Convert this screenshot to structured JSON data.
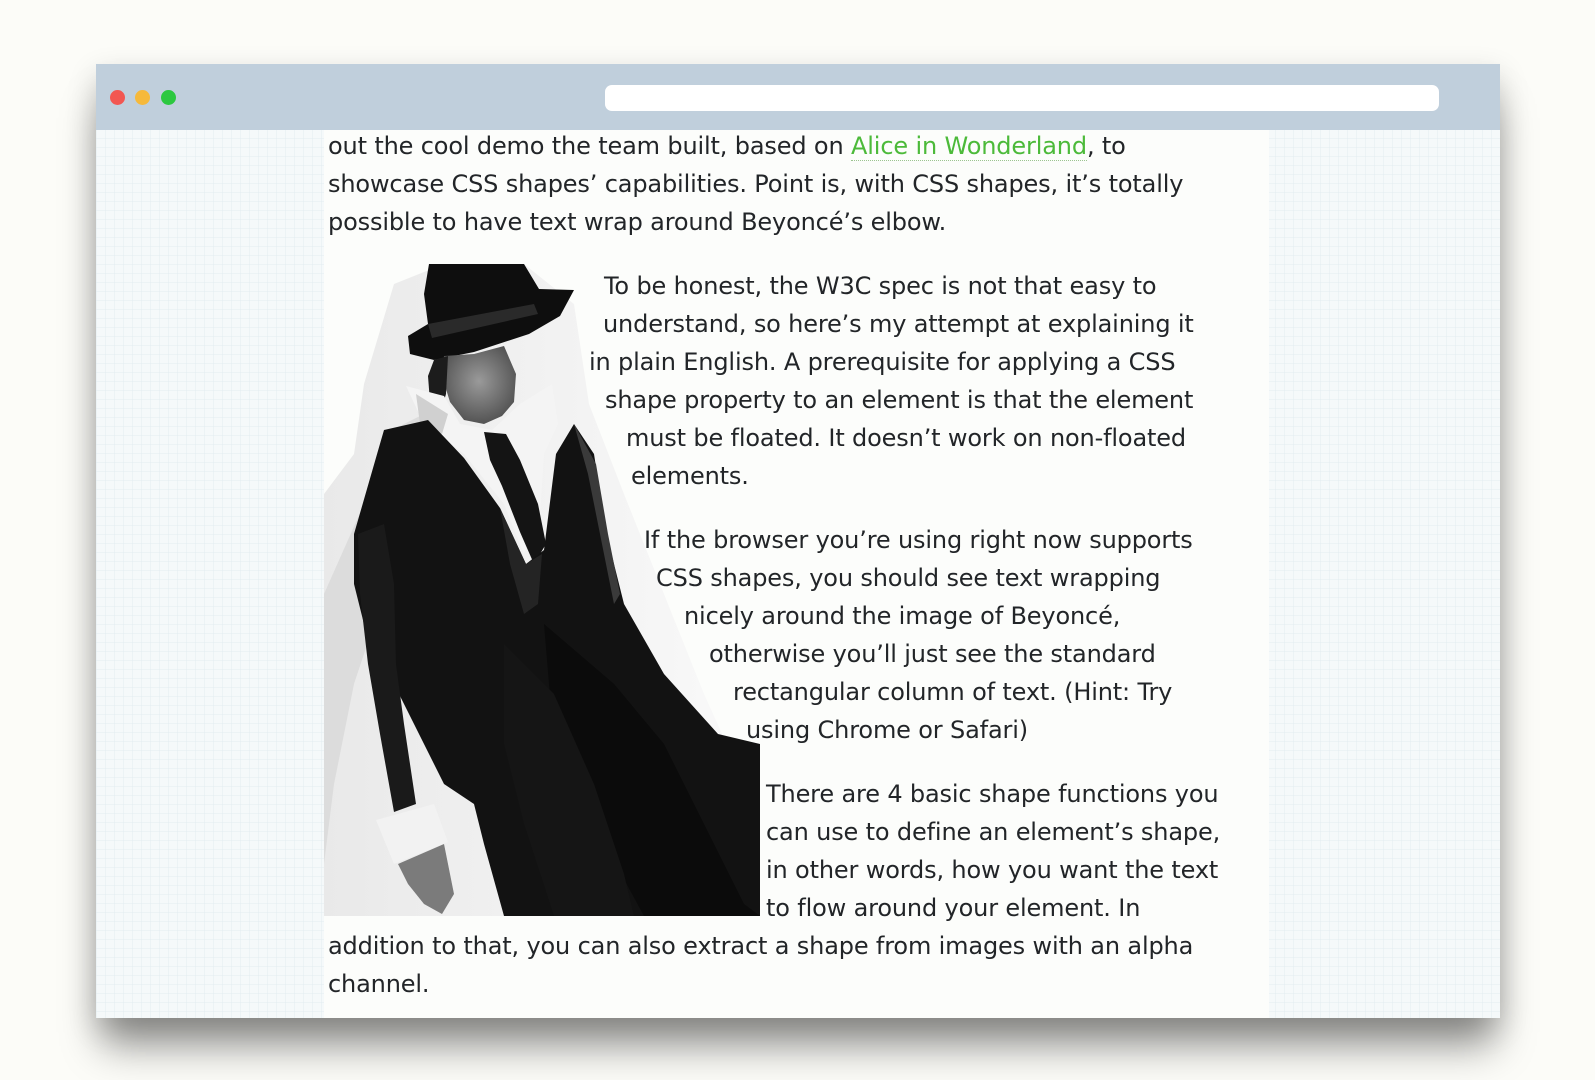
{
  "intro": {
    "line1_before": "out the cool demo the team built, based on ",
    "line1_link": "Alice in Wonderland",
    "line1_after": ", to",
    "line2": "showcase CSS shapes’ capabilities. Point is, with CSS shapes, it’s totally",
    "line3": "possible to have text wrap around Beyoncé’s elbow."
  },
  "para1": {
    "lines": [
      "To be honest, the W3C spec is not that easy to",
      "understand, so here’s my attempt at explaining it",
      "in plain English. A prerequisite for applying a CSS",
      "shape property to an element is that the element",
      "must be floated. It doesn’t work on non-floated",
      "elements."
    ]
  },
  "para2": {
    "lines": [
      "If the browser you’re using right now supports",
      "CSS shapes, you should see text wrapping",
      "nicely around the image of Beyoncé,",
      "otherwise you’ll just see the standard",
      "rectangular column of text. (Hint: Try",
      "using Chrome or Safari)"
    ]
  },
  "para3": {
    "lines": [
      "There are 4 basic shape functions you",
      "can use to define an element’s shape,",
      "in other words, how you want the text",
      "to flow around your element. In",
      "addition to that, you can also extract a shape from images with an alpha",
      "channel."
    ]
  },
  "colors": {
    "link": "#4cba3a",
    "titlebar": "#c0cfdc",
    "close": "#f25752",
    "minimize": "#f6b93b",
    "maximize": "#2cc840"
  }
}
